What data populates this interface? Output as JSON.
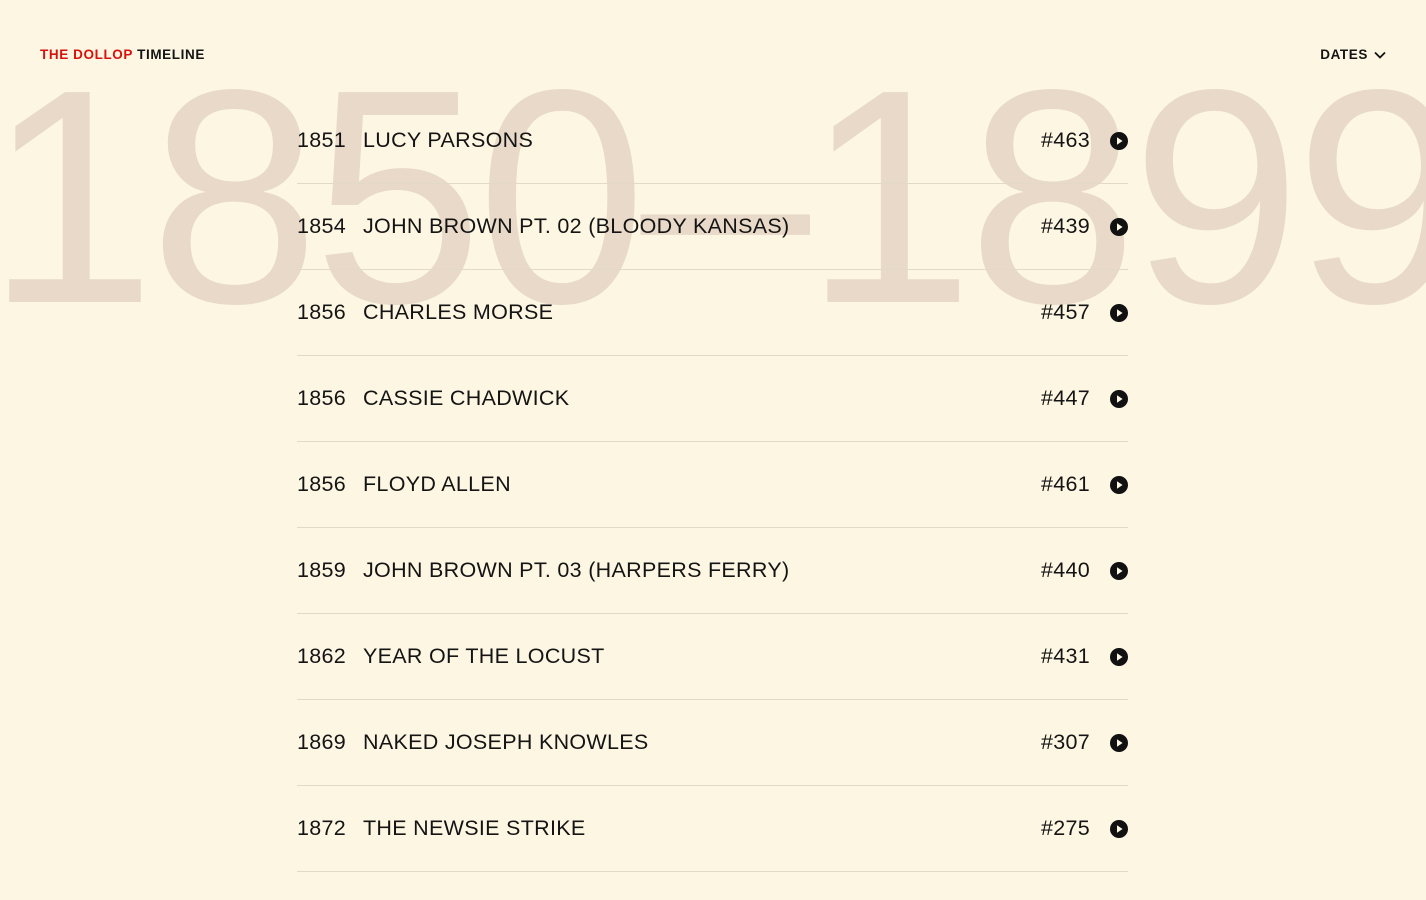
{
  "header": {
    "brand_red": "THE DOLLOP",
    "brand_dark": "TIMELINE",
    "dates_label": "DATES"
  },
  "era_label": "1850–1899",
  "episodes": [
    {
      "year": "1851",
      "title": "LUCY PARSONS",
      "number": "#463"
    },
    {
      "year": "1854",
      "title": "JOHN BROWN PT. 02 (BLOODY KANSAS)",
      "number": "#439"
    },
    {
      "year": "1856",
      "title": "CHARLES MORSE",
      "number": "#457"
    },
    {
      "year": "1856",
      "title": "CASSIE CHADWICK",
      "number": "#447"
    },
    {
      "year": "1856",
      "title": "FLOYD ALLEN",
      "number": "#461"
    },
    {
      "year": "1859",
      "title": "JOHN BROWN PT. 03 (HARPERS FERRY)",
      "number": "#440"
    },
    {
      "year": "1862",
      "title": "YEAR OF THE LOCUST",
      "number": "#431"
    },
    {
      "year": "1869",
      "title": "NAKED JOSEPH KNOWLES",
      "number": "#307"
    },
    {
      "year": "1872",
      "title": "THE NEWSIE STRIKE",
      "number": "#275"
    }
  ],
  "icons": {
    "row_action": "play-icon",
    "dates_toggle": "chevron-down-icon"
  },
  "colors": {
    "background": "#fdf6e3",
    "brand_accent": "#d9100c",
    "text": "#141414",
    "era_watermark": "#e8d9c8",
    "divider": "#e3d9c9"
  }
}
